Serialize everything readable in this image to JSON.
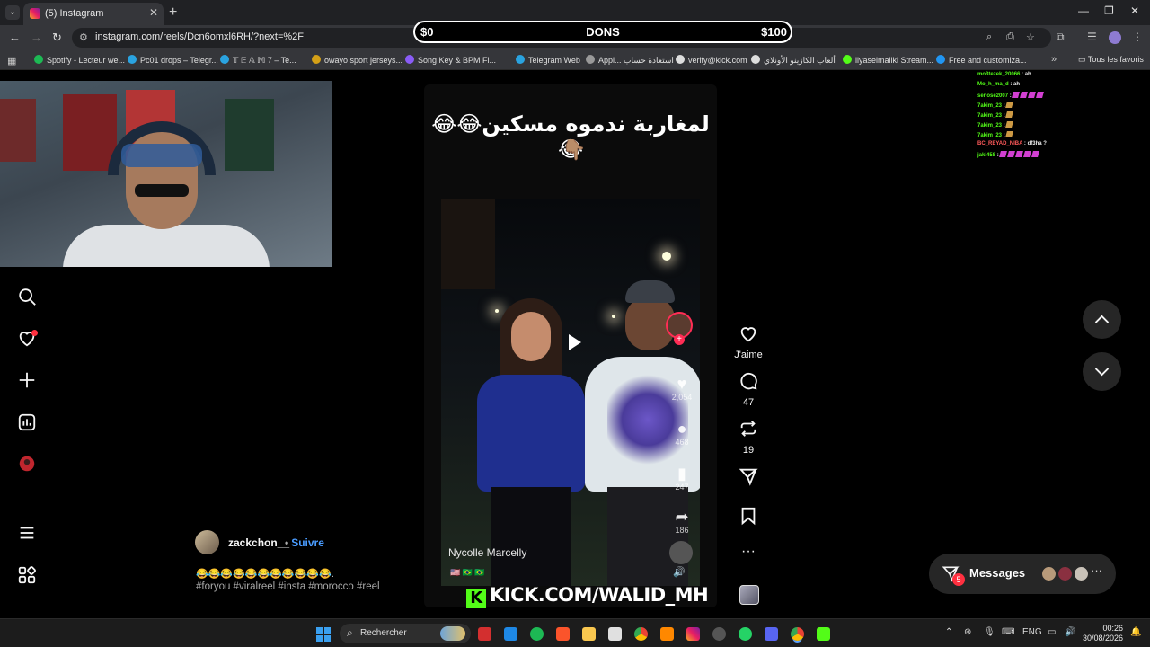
{
  "browser": {
    "tab_title": "(5) Instagram",
    "url": "instagram.com/reels/Dcn6omxl6RH/?next=%2F",
    "bookmarks": [
      {
        "label": "Spotify - Lecteur we...",
        "color": "#1db954"
      },
      {
        "label": "Pc01 drops – Telegr...",
        "color": "#2aa3e0"
      },
      {
        "label": "𝕋 𝔼 𝔸 𝕄 7 – Te...",
        "color": "#2aa3e0"
      },
      {
        "label": "owayo sport jerseys...",
        "color": "#d4a017"
      },
      {
        "label": "Song Key & BPM Fi...",
        "color": "#8a5cf6"
      },
      {
        "label": "Telegram Web",
        "color": "#2aa3e0"
      },
      {
        "label": "Appl... استعادة حساب",
        "color": "#999999"
      },
      {
        "label": "verify@kick.com",
        "color": "#dddddd"
      },
      {
        "label": "ألعاب الكازينو الأونلاي",
        "color": "#dddddd"
      },
      {
        "label": "ilyaselmaliki Stream...",
        "color": "#53fc18"
      },
      {
        "label": "Free and customiza...",
        "color": "#2196f3"
      }
    ],
    "bookmarks_folder": "Tous les favoris"
  },
  "donation_bar": {
    "min": "$0",
    "label": "DONS",
    "max": "$100"
  },
  "reel": {
    "caption_ar": "لمغاربة ندموه مسكين😂😂😂",
    "pointing_emoji": "👇🏽",
    "overlay_name": "Nycolle Marcelly",
    "overlay_flags": "🇺🇸 🇧🇷 🇧🇷",
    "inner_stats": [
      "2,054",
      "468",
      "247",
      "186"
    ],
    "stream_link": "KICK.COM/WALID_MH"
  },
  "actions": {
    "like_label": "J'aime",
    "comments_count": "47",
    "reposts_count": "19"
  },
  "author": {
    "username": "zackchon__",
    "follow_label": "Suivre",
    "caption_emojis": "😂😂😂😂😂😂😂😂😂😂😂.",
    "hashtags": "#foryou #viralreel #insta #morocco #reel"
  },
  "messages": {
    "label": "Messages",
    "badge": "5"
  },
  "chat": [
    {
      "user": "mo3tezek_20066",
      "text": "ah"
    },
    {
      "user": "Mo_h_ma_d",
      "text": "ah"
    },
    {
      "user": "senose2007",
      "text": "",
      "emotes": 4
    },
    {
      "user": "7akim_23",
      "text": "",
      "emotes": 1
    },
    {
      "user": "7akim_23",
      "text": "",
      "emotes": 1
    },
    {
      "user": "7akim_23",
      "text": "",
      "emotes": 1
    },
    {
      "user": "7akim_23",
      "text": "",
      "emotes": 1
    },
    {
      "user": "BC_REYAD_NIBA",
      "text": "df3ha ?"
    },
    {
      "user": "jaki458",
      "text": "",
      "emotes": 5
    }
  ],
  "taskbar": {
    "search_label": "Rechercher",
    "lang": "ENG",
    "time": "00:26",
    "date": "30/08/2026"
  }
}
